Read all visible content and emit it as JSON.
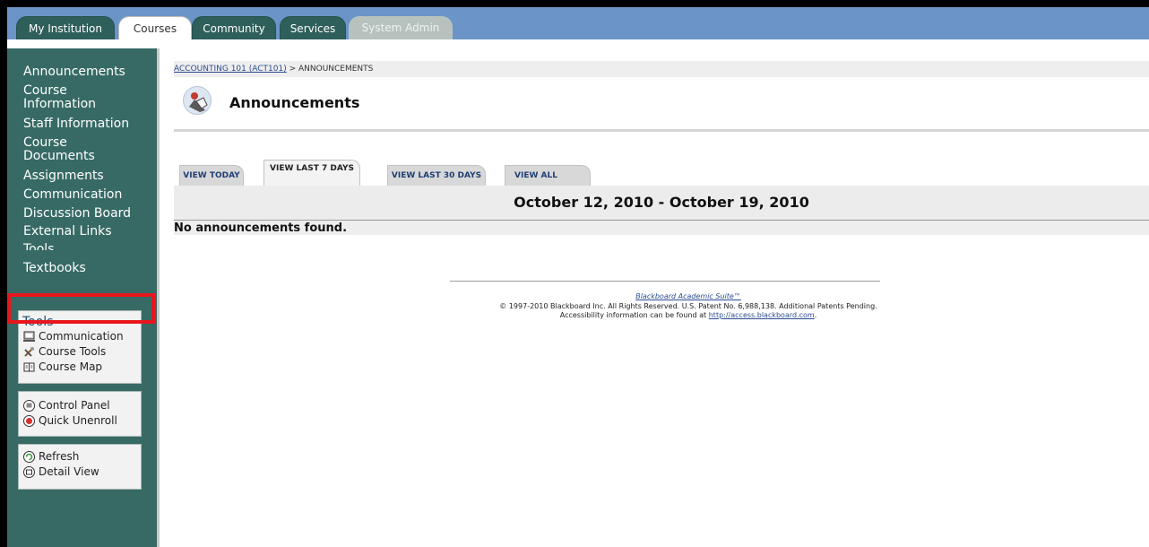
{
  "nav": {
    "tabs": [
      {
        "label": "My Institution"
      },
      {
        "label": "Courses"
      },
      {
        "label": "Community"
      },
      {
        "label": "Services"
      },
      {
        "label": "System Admin"
      }
    ]
  },
  "sidebar": {
    "items": [
      {
        "label": "Announcements"
      },
      {
        "label": "Course\nInformation"
      },
      {
        "label": "Staff Information"
      },
      {
        "label": "Course\nDocuments"
      },
      {
        "label": "Assignments"
      },
      {
        "label": "Communication"
      },
      {
        "label": "Discussion Board"
      },
      {
        "label": "External Links"
      },
      {
        "label": "Tools"
      },
      {
        "label": "Textbooks"
      }
    ],
    "tools_title": "Tools",
    "tools": [
      "Communication",
      "Course Tools",
      "Course Map"
    ],
    "panel": [
      "Control Panel",
      "Quick Unenroll"
    ],
    "view": [
      "Refresh",
      "Detail View"
    ]
  },
  "content": {
    "breadcrumb": {
      "course": "ACCOUNTING 101 (ACT101)",
      "separator": " > ",
      "page": "ANNOUNCEMENTS"
    },
    "title": "Announcements",
    "filter_tabs": [
      "VIEW TODAY",
      "VIEW LAST 7 DAYS",
      "VIEW LAST 30 DAYS",
      "VIEW ALL"
    ],
    "date_range": "October 12, 2010 - October 19, 2010",
    "empty_message": "No announcements found."
  },
  "footer": {
    "product": "Blackboard Academic Suite™",
    "copyright": "© 1997-2010 Blackboard Inc. All Rights Reserved. U.S. Patent No. 6,988,138. Additional Patents Pending.",
    "access_prefix": "Accessibility information can be found at ",
    "access_link": "http://access.blackboard.com",
    "access_suffix": "."
  },
  "colors": {
    "nav_bg": "#6b95c8",
    "sidebar_bg": "#376a65",
    "highlight": "#e8161c"
  }
}
